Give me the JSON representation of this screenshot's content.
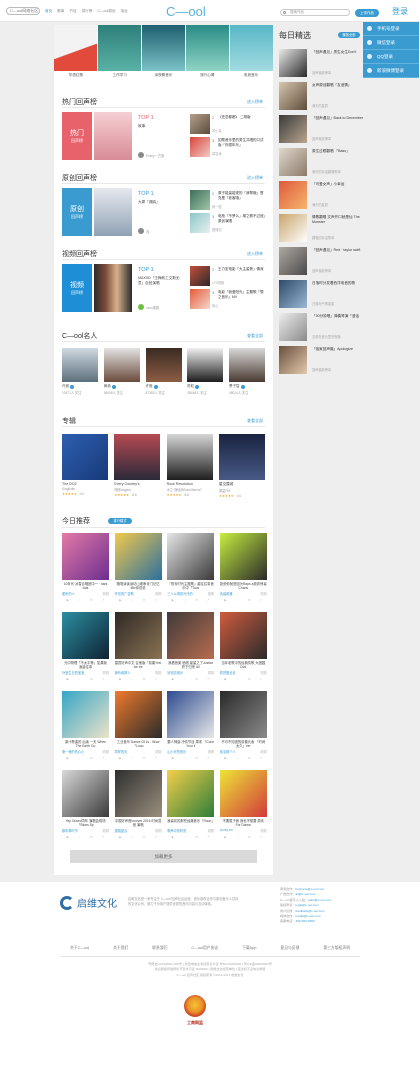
{
  "header": {
    "logo_text": "C—ool网络社区",
    "nav": [
      "首页",
      "歌单",
      "节目",
      "排行榜",
      "C—ool原创",
      "电台"
    ],
    "brand": "C—ool",
    "search_placeholder": "搜索作品",
    "upload_button": "上传作品",
    "login": "登录"
  },
  "login_menu": [
    "手机号登录",
    "微信登录",
    "QQ登录",
    "新浪微博登录"
  ],
  "banner_categories": [
    "华语红歌",
    "工作学习",
    "深夜聊音乐",
    "旅行心情",
    "电竞音乐"
  ],
  "sections": {
    "hot": {
      "title": "热门回声榜",
      "more": "进入榜单",
      "cover_line1": "热门",
      "cover_line2": "回声榜",
      "top1": "TOP 1",
      "top1_name": "故事",
      "top1_user": "Every一方旅",
      "items": [
        {
          "rank": "2",
          "title": "《还恋都都》 二胡版",
          "sub": "琴小呆"
        },
        {
          "rank": "3",
          "title": "如歌音乐里的男生共唱的口试版「你很年乐」",
          "sub": "郭昱涛"
        }
      ]
    },
    "original": {
      "title": "原创回声榜",
      "more": "进入榜单",
      "cover_line1": "原创",
      "cover_line2": "回声榜",
      "top1": "TOP 1",
      "top1_name": "大雾「湖鸥」",
      "top1_user": "浅",
      "items": [
        {
          "rank": "2",
          "title": "原子能量能现的「我帮哦」冒充是「老客哦」",
          "sub": "雨一狐"
        },
        {
          "rank": "3",
          "title": "电枪「不罗么」棉之歌不过冠」原创演唱",
          "sub": "翅翅羽"
        }
      ]
    },
    "video": {
      "title": "视频回声榜",
      "more": "进入榜单",
      "cover_line1": "视频",
      "cover_line2": "回声榜",
      "top1": "TOP 1",
      "top1_name": "MAXXD「王梅转工文斯无意」自拍演唱",
      "top1_user": "xxxx视频",
      "items": [
        {
          "rank": "2",
          "title": "王力宏电影「大主姿势」情深",
          "sub": "LFS视频"
        },
        {
          "rank": "3",
          "title": "电影「我爱阳光」主题歌「想之音乐」MV",
          "sub": "雨心"
        }
      ]
    }
  },
  "stars": {
    "title": "C—ool名人",
    "more": "查看全部",
    "list": [
      {
        "name": "许嵩",
        "fans": "10471人 关注"
      },
      {
        "name": "黄渤",
        "fans": "98458人 关注"
      },
      {
        "name": "许嵩",
        "fans": "87363人 关注"
      },
      {
        "name": "陈粒",
        "fans": "38448人 关注"
      },
      {
        "name": "萧子智",
        "fans": "48024人 关注"
      }
    ]
  },
  "albums": {
    "title": "专辑",
    "more": "查看全部",
    "list": [
      {
        "name": "The DOZ",
        "sub": "Kingfiolle",
        "stars": "★★★★★",
        "score": "0.0"
      },
      {
        "name": "Every Country's",
        "sub": "嘿嘿Angeal",
        "stars": "★★★★★",
        "score": "8.6"
      },
      {
        "name": "Rock Revolution",
        "sub": "水之·静谧雨Sunn5terns7",
        "stars": "★★★★★",
        "score": "8.6"
      },
      {
        "name": "星空露城",
        "sub": "繁星FM",
        "stars": "★★★★★",
        "score": "0.0"
      }
    ]
  },
  "recommend": {
    "title": "今日推荐",
    "badge": "排行模式",
    "items": [
      {
        "title": "10年代·冰雪合唱团中一 · dark clas",
        "author": "爱听的人",
        "time": "刚刚"
      },
      {
        "title": "随笔读读读坊山坡串青门记忆Mix你说说",
        "author": "环岛的广告歌",
        "time": "刚刚"
      },
      {
        "title": "「恒青时代主题歌」越往往事音乐中「Tous",
        "author": "三人以得到冷冷的",
        "time": "刚刚"
      },
      {
        "title": "拒绝你就是因为Raps a放弃惊喜 Chans",
        "author": "伪装和雅",
        "time": "刚刚"
      },
      {
        "title": "光中物理「不太平等」如果我 凌晨往事",
        "author": "外婆生日的宝宝",
        "time": "刚刚"
      },
      {
        "title": "雷霆好声中文 吉他版「前奏Yes! Ive be",
        "author": "静听着那么",
        "time": "刚刚"
      },
      {
        "title": "我看音楽 绝唱 星星之了Justice终于归来 Ail",
        "author": "铃铛清音乐",
        "time": "刚刚"
      },
      {
        "title": "当年老歌中的经典情歌 大团圆 Dvd",
        "author": "的拼图全靠",
        "time": "刚刚"
      },
      {
        "title": "原汁歌曲的 后续 一天 When The Earth Go",
        "author": "第一夜的伤心小",
        "time": "刚刚"
      },
      {
        "title": "工业音乐 Dance Of 1s - Wow「Louo",
        "author": "同样的天",
        "time": "刚刚"
      },
      {
        "title": "要人神曲 冷情节目 周末 「Color Your li",
        "author": "山小可的音乐",
        "time": "刚刚"
      },
      {
        "title": "不可不知道的前奏元素 「时间太久」ver",
        "author": "依靠那个人",
        "time": "刚刚"
      },
      {
        "title": "Yep Gusev同年 演唱会现场「Blues Sp",
        "author": "那年那时节",
        "time": "刚刚"
      },
      {
        "title": "中国好声音Innover 2016 时尚混音 演唱",
        "author": "蛋糕甜点",
        "time": "刚刚"
      },
      {
        "title": "我喜欢的那些经典音乐「Roun」",
        "author": "歌声中的听觉",
        "time": "刚刚"
      },
      {
        "title": "不要属于我 我也不想要 周末 For Dance",
        "author": "Lucky-fm",
        "time": "刚刚"
      }
    ],
    "load_more": "加载更多"
  },
  "daily": {
    "title": "每日精选",
    "badge": "播放全部",
    "items": [
      {
        "category": "",
        "title": "「回声遇见」男生女生Don't",
        "count": "回声播放榜单"
      },
      {
        "category": "",
        "title": "女声原创翻唱「友谊情」",
        "count": "满天的星辰"
      },
      {
        "category": "",
        "title": "「回声遇见」Back to December",
        "count": "回声播放榜单"
      },
      {
        "category": "",
        "title": "原生过眼翻唱 「Bass」",
        "count": "美好的民谣翻唱歌单"
      },
      {
        "category": "",
        "title": "「可爱女声」小幸运",
        "count": "满天的星辰"
      },
      {
        "category": "",
        "title": "情歌翻唱 文声开口就是仙 The Monster",
        "count": "翻唱的民谣歌单"
      },
      {
        "category": "",
        "title": "「回声遇见」Red · taylor swift",
        "count": "回声播放榜单"
      },
      {
        "category": "",
        "title": "日落时分发着西洋电音的歌",
        "count": "日落电气歌曲集"
      },
      {
        "category": "",
        "title": "「30分钟唱」弹奏琴演「漫话",
        "count": "沉浸在音乐里的夜晚"
      },
      {
        "category": "",
        "title": "「独家回声篇」Apologize",
        "count": "回声播放榜单"
      }
    ]
  },
  "footer": {
    "company": "启维文化",
    "about": "启维文化是一家专注于 C—ool 回声社区运营、音乐版权合作与原创音乐人扶持的文化公司，致力于为用户提供优质的音乐内容与互动体验。",
    "contacts": [
      {
        "label": "商务合作：",
        "value": "business@c-ool.com"
      },
      {
        "label": "广告合作：",
        "value": "ad@c-ool.com"
      },
      {
        "label": "C—ool音乐人入驻：",
        "value": "artist@c-ool.com"
      },
      {
        "label": "版权申诉：",
        "value": "legal@c-ool.com"
      },
      {
        "label": "用户反馈：",
        "value": "feedback@c-ool.com"
      },
      {
        "label": "媒体合作：",
        "value": "media@c-ool.com"
      },
      {
        "label": "客服电话：",
        "value": "400-000-0000"
      }
    ],
    "links": [
      "关于C—ool",
      "关于我们",
      "联系我们",
      "C—ool用户协议",
      "下载App",
      "意见与反馈",
      "第三方版权声明"
    ],
    "legal": [
      "粤网文[2016]0000-000号 | 增值电信业务经营许可证 粤B2-00000000 | 粤ICP备00000000号",
      "信息网络传播视听节目许可证 0000000 | 网络文化经营单位 | 违法和不良信息举报",
      "C—ool 回声社区 版权所有 ©2016-2017 启维文化"
    ],
    "seal_text": "工商网监"
  },
  "colors": {
    "accent": "#3a9bd1",
    "hot_cover": "#e8626c",
    "original_cover": "#3a9bd1",
    "video_cover": "#1e8fd6"
  }
}
